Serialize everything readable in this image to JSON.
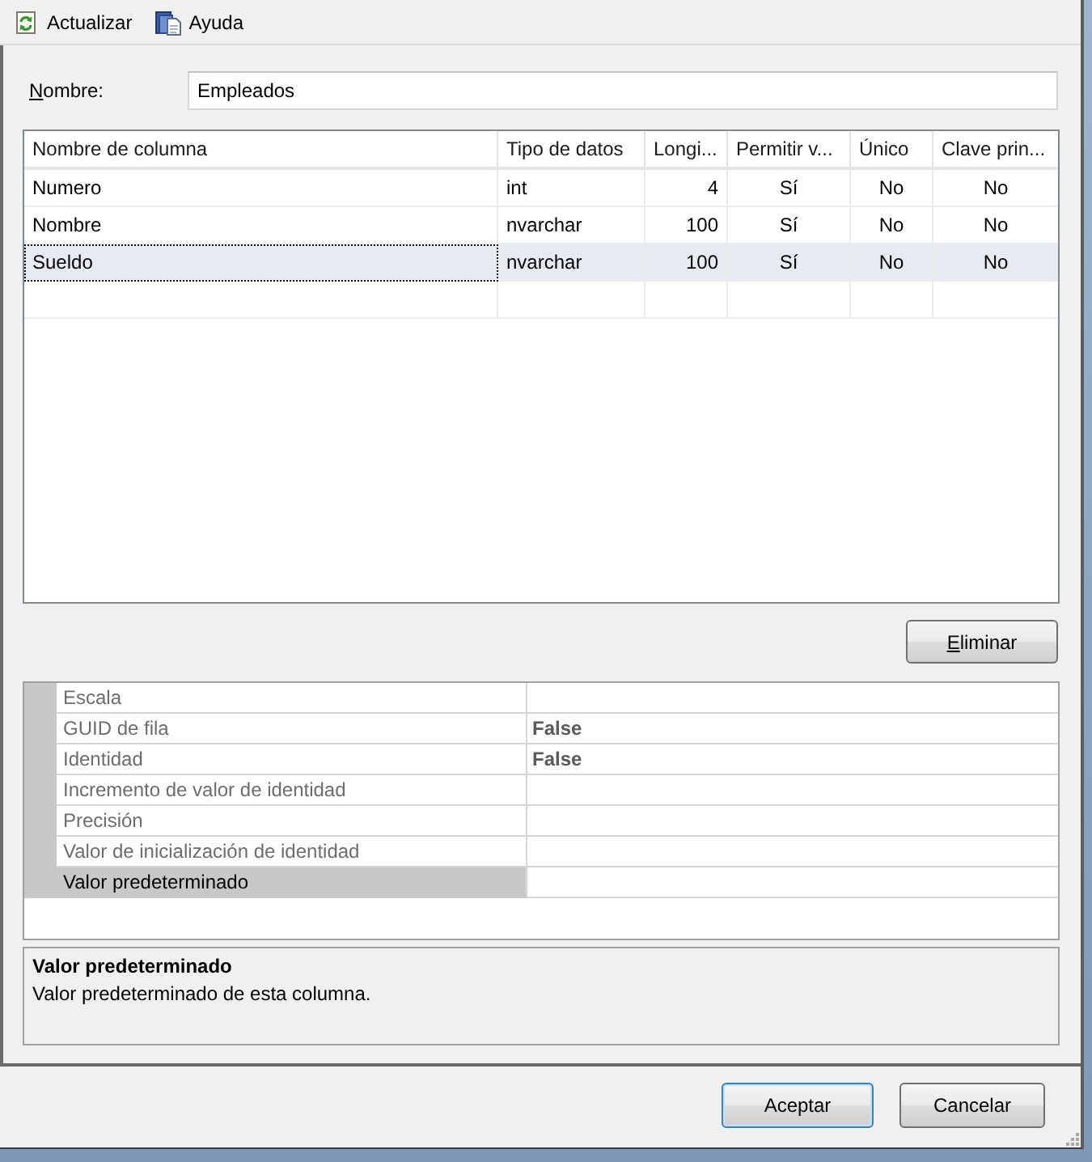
{
  "toolbar": [
    {
      "label": "Actualizar"
    },
    {
      "label": "Ayuda"
    }
  ],
  "name_field": {
    "label": "Nombre:",
    "access_key": true,
    "value": "Empleados"
  },
  "table": {
    "columns": [
      {
        "label": "Nombre de columna",
        "kind": "text"
      },
      {
        "label": "Tipo de datos",
        "kind": "text"
      },
      {
        "label": "Longi...",
        "kind": "number"
      },
      {
        "label": "Permitir v...",
        "kind": "flag"
      },
      {
        "label": "Único",
        "kind": "flag"
      },
      {
        "label": "Clave prin...",
        "kind": "flag"
      }
    ],
    "rows": [
      {
        "cells": [
          "Numero",
          "int",
          "4",
          "Sí",
          "No",
          "No"
        ],
        "selected": false
      },
      {
        "cells": [
          "Nombre",
          "nvarchar",
          "100",
          "Sí",
          "No",
          "No"
        ],
        "selected": false
      },
      {
        "cells": [
          "Sueldo",
          "nvarchar",
          "100",
          "Sí",
          "No",
          "No"
        ],
        "selected": true
      }
    ]
  },
  "delete_button": {
    "label": "Eliminar",
    "access_key": true
  },
  "properties": [
    {
      "name": "Escala",
      "read_only": true,
      "selected": false
    },
    {
      "name": "GUID de fila",
      "value": "False",
      "read_only": true,
      "selected": false
    },
    {
      "name": "Identidad",
      "value": "False",
      "read_only": true,
      "selected": false
    },
    {
      "name": "Incremento de valor de identidad",
      "read_only": true,
      "selected": false
    },
    {
      "name": "Precisión",
      "read_only": true,
      "selected": false
    },
    {
      "name": "Valor de inicialización de identidad",
      "read_only": true,
      "selected": false
    },
    {
      "name": "Valor predeterminado",
      "read_only": false,
      "selected": true
    }
  ],
  "description": {
    "title": "Valor predeterminado",
    "text": "Valor predeterminado de esta columna."
  },
  "buttons": [
    {
      "label": "Aceptar",
      "default": true
    },
    {
      "label": "Cancelar",
      "default": false
    }
  ]
}
